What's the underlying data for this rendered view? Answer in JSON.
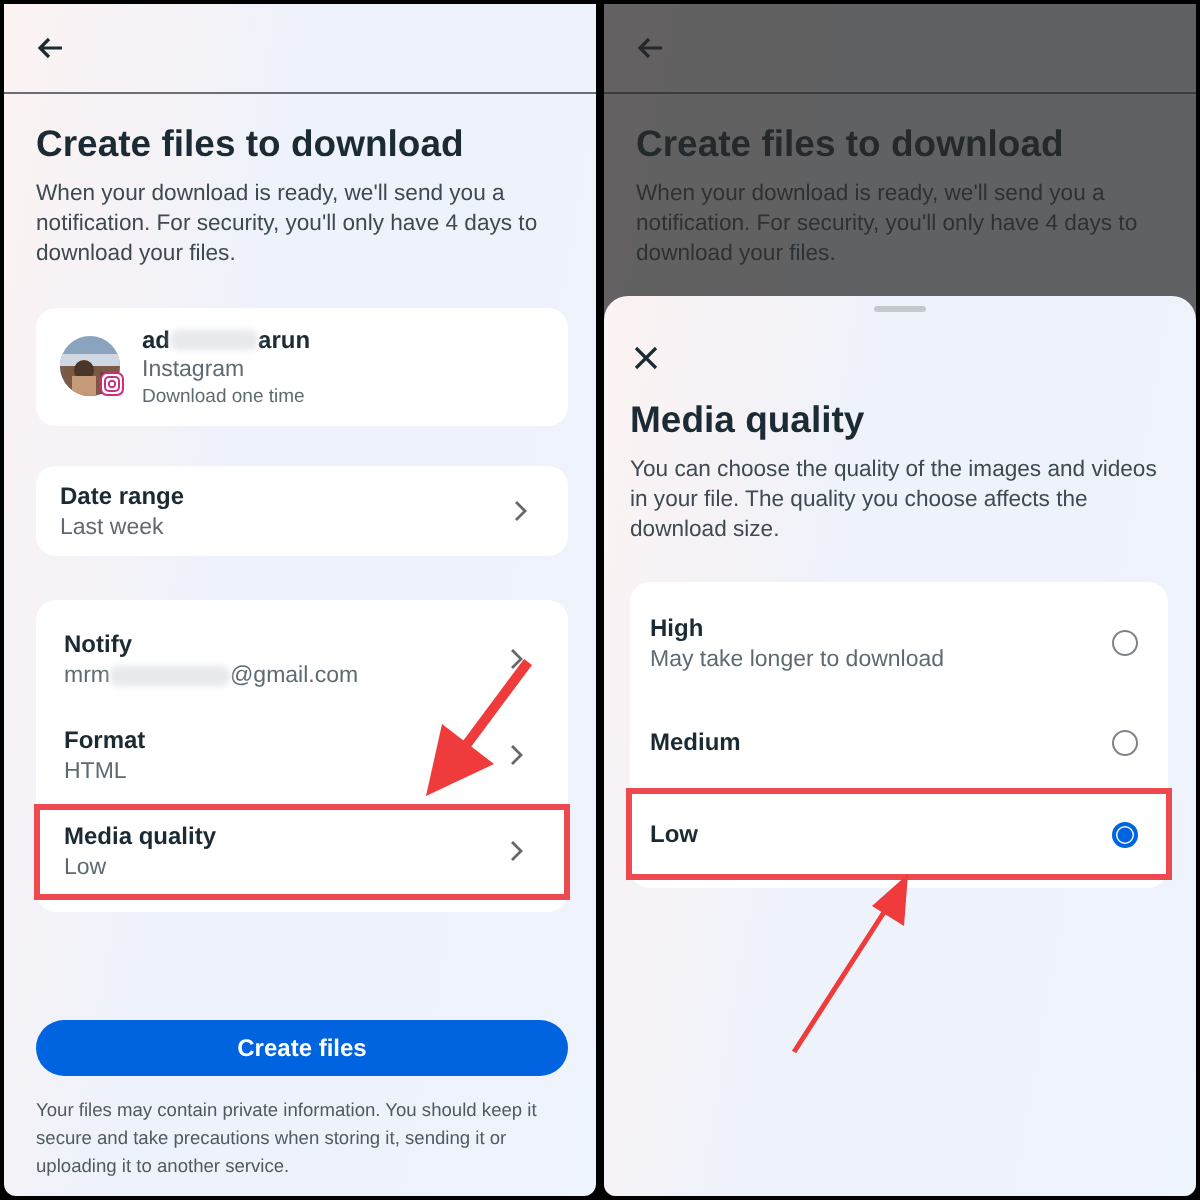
{
  "left_screen": {
    "title": "Create files to download",
    "description": "When your download is ready, we'll send you a notification. For security, you'll only have 4 days to download your files.",
    "account": {
      "name_start": "ad",
      "name_end": "arun",
      "platform": "Instagram",
      "frequency": "Download one time"
    },
    "date_range": {
      "label": "Date range",
      "value": "Last week"
    },
    "settings": [
      {
        "label": "Notify",
        "value_start": "mrm",
        "value_end": "@gmail.com",
        "annotated": false
      },
      {
        "label": "Format",
        "value_start": "HTML",
        "annotated": false
      },
      {
        "label": "Media quality",
        "value_start": "Low",
        "annotated": true
      }
    ],
    "button": "Create files",
    "footer": "Your files may contain private information. You should keep it secure and take precautions when storing it, sending it or uploading it to another service."
  },
  "right_screen": {
    "background": {
      "title": "Create files to download",
      "description": "When your download is ready, we'll send you a notification. For security, you'll only have 4 days to download your files."
    },
    "sheet": {
      "title": "Media quality",
      "description": "You can choose the quality of the images and videos in your file. The quality you choose affects the download size.",
      "options": [
        {
          "label": "High",
          "hint": "May take longer to download",
          "selected": false,
          "annotated": false
        },
        {
          "label": "Medium",
          "selected": false,
          "annotated": false
        },
        {
          "label": "Low",
          "selected": true,
          "annotated": true
        }
      ]
    }
  }
}
